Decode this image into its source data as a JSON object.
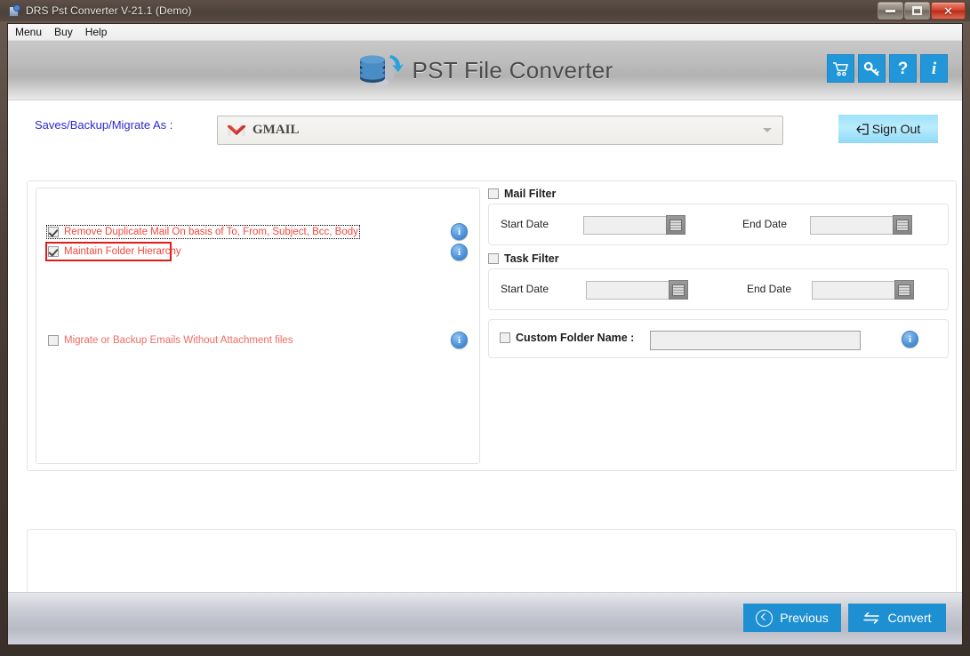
{
  "window": {
    "title": "DRS Pst Converter V-21.1 (Demo)",
    "title_icon": "app-icon",
    "buttons": {
      "minimize": "minimize-button",
      "maximize": "maximize-button",
      "close": "✕"
    }
  },
  "menubar": {
    "items": [
      {
        "label": "Menu"
      },
      {
        "label": "Buy"
      },
      {
        "label": "Help"
      }
    ]
  },
  "banner": {
    "brand_text": "PST File Converter",
    "logo": "database-wrench-logo",
    "tool_buttons": [
      {
        "name": "cart-icon",
        "glyph": "🛒"
      },
      {
        "name": "key-icon",
        "glyph": "🔑"
      },
      {
        "name": "help-icon",
        "glyph": "?"
      },
      {
        "name": "info-icon",
        "glyph": "i"
      }
    ]
  },
  "save_as": {
    "label": "Saves/Backup/Migrate As :",
    "selected": "GMAIL",
    "icon": "gmail-icon",
    "sign_out_label": "Sign Out"
  },
  "options": {
    "items": [
      {
        "label": "Remove Duplicate Mail On basis of To, From, Subject, Bcc, Body",
        "checked": true,
        "focused": true
      },
      {
        "label": "Maintain Folder Hierarchy",
        "checked": true,
        "highlighted": true
      },
      {
        "label": "Migrate or Backup Emails Without Attachment files",
        "checked": false,
        "dim": true
      }
    ],
    "info_glyph": "i"
  },
  "mail_filter": {
    "title": "Mail Filter",
    "checked": false,
    "start_label": "Start Date",
    "start_value": "",
    "end_label": "End Date",
    "end_value": ""
  },
  "task_filter": {
    "title": "Task Filter",
    "checked": false,
    "start_label": "Start Date",
    "start_value": "",
    "end_label": "End Date",
    "end_value": ""
  },
  "custom_folder": {
    "label": "Custom Folder Name :",
    "checked": false,
    "value": "",
    "info_glyph": "i"
  },
  "log": {
    "text": ""
  },
  "footer": {
    "previous_label": "Previous",
    "convert_label": "Convert"
  },
  "colors": {
    "accent_blue": "#1e90d2",
    "tool_blue": "#2196d8",
    "option_red": "#f0473f",
    "highlight_red": "#e01b1b",
    "link_blue": "#2a2ad0",
    "signout_cyan": "#9fe2fa"
  }
}
